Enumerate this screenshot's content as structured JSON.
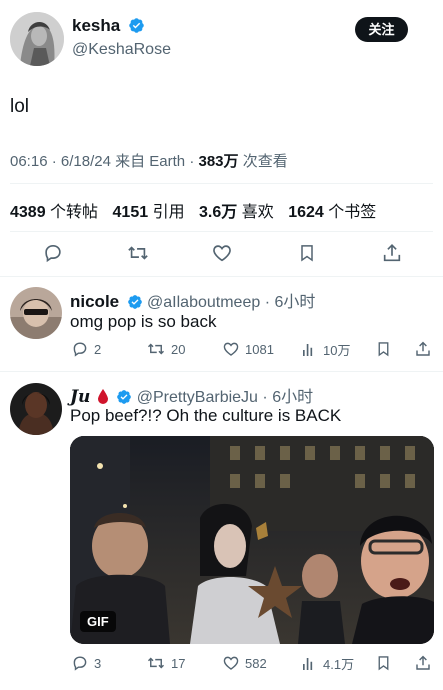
{
  "main_tweet": {
    "display_name": "kesha",
    "handle": "@KeshaRose",
    "follow_label": "关注",
    "text": "lol",
    "time": "06:16",
    "sep1": "·",
    "date": "6/18/24",
    "source": "来自 Earth",
    "sep2": "·",
    "views_value": "383万",
    "views_label": "次查看",
    "stats": {
      "retweets": "4389",
      "retweets_label": "个转帖",
      "quotes": "4151",
      "quotes_label": "引用",
      "likes": "3.6万",
      "likes_label": "喜欢",
      "bookmarks": "1624",
      "bookmarks_label": "个书签"
    }
  },
  "replies": [
    {
      "display_name": "nicole",
      "handle": "@aIlaboutmeep",
      "sep": "·",
      "time": "6小时",
      "text": "omg pop is so back",
      "replies": "2",
      "retweets": "20",
      "likes": "1081",
      "views": "10万"
    },
    {
      "display_name": "Ju",
      "handle": "@PrettyBarbieJu",
      "sep": "·",
      "time": "6小时",
      "text": "Pop beef?!? Oh the culture is BACK",
      "media_badge": "GIF",
      "replies": "3",
      "retweets": "17",
      "likes": "582",
      "views": "4.1万"
    }
  ],
  "colors": {
    "verified": "#1d9bf0",
    "secondary_text": "#536471",
    "follow_button": "#0f1419",
    "blood_drop": "#d0142c"
  },
  "icons": [
    "verified-badge-icon",
    "reply-icon",
    "retweet-icon",
    "like-icon",
    "bookmark-icon",
    "share-icon",
    "views-icon",
    "blood-drop-icon"
  ]
}
